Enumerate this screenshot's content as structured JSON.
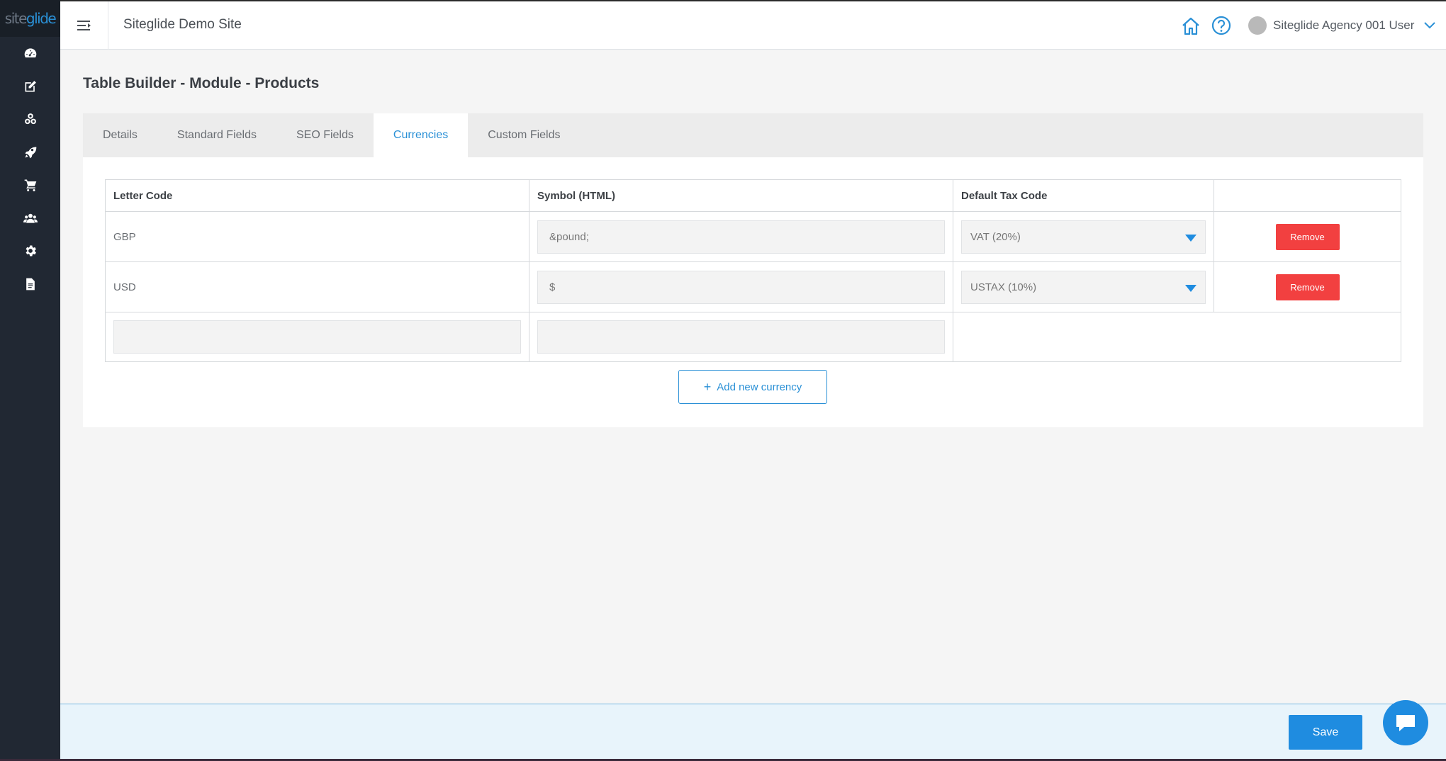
{
  "sidebar": {
    "logo": {
      "part1": "site",
      "part2": "glide"
    },
    "items": [
      {
        "icon": "dashboard-icon"
      },
      {
        "icon": "edit-icon"
      },
      {
        "icon": "modules-icon"
      },
      {
        "icon": "rocket-icon"
      },
      {
        "icon": "cart-icon"
      },
      {
        "icon": "users-icon"
      },
      {
        "icon": "settings-icon"
      },
      {
        "icon": "document-icon"
      }
    ]
  },
  "topbar": {
    "site_name": "Siteglide Demo Site",
    "user_name": "Siteglide Agency 001 User"
  },
  "page": {
    "title": "Table Builder - Module - Products",
    "tabs": [
      {
        "label": "Details",
        "active": false
      },
      {
        "label": "Standard Fields",
        "active": false
      },
      {
        "label": "SEO Fields",
        "active": false
      },
      {
        "label": "Currencies",
        "active": true
      },
      {
        "label": "Custom Fields",
        "active": false
      }
    ]
  },
  "table": {
    "headers": {
      "letter_code": "Letter Code",
      "symbol": "Symbol (HTML)",
      "tax_code": "Default Tax Code"
    },
    "rows": [
      {
        "letter_code": "GBP",
        "symbol": "&pound;",
        "tax_code": "VAT (20%)",
        "remove_label": "Remove"
      },
      {
        "letter_code": "USD",
        "symbol": "$",
        "tax_code": "USTAX (10%)",
        "remove_label": "Remove"
      }
    ],
    "new_row": {
      "letter_code": "",
      "symbol": ""
    }
  },
  "actions": {
    "add_currency_label": "Add new currency",
    "save_label": "Save"
  },
  "colors": {
    "accent": "#2a90d6",
    "danger": "#f24040",
    "sidebar": "#212833"
  }
}
